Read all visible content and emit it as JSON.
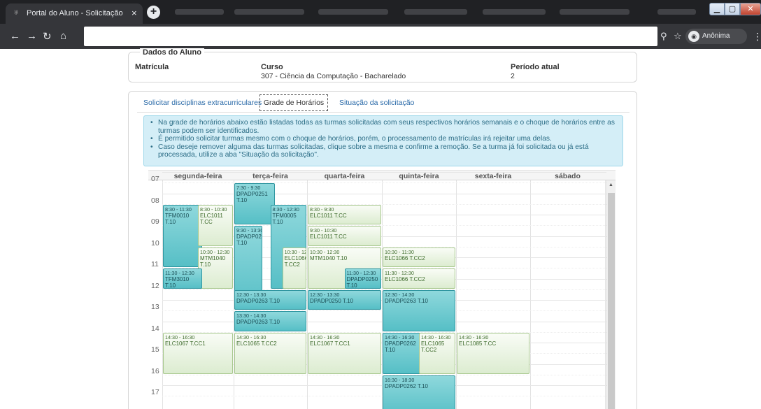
{
  "browser": {
    "tab_title": "Portal do Aluno - Solicitação de",
    "tab_close": "×",
    "new_tab": "+",
    "incognito_label": "Anônima"
  },
  "aluno": {
    "legend": "Dados do Aluno",
    "matricula_label": "Matrícula",
    "curso_label": "Curso",
    "curso_value": "307 - Ciência da Computação - Bacharelado",
    "periodo_label": "Período atual",
    "periodo_value": "2"
  },
  "tabs": [
    {
      "label": "Solicitar disciplinas extracurriculares"
    },
    {
      "label": "Grade de Horários"
    },
    {
      "label": "Situação da solicitação"
    }
  ],
  "alert": [
    "Na grade de horários abaixo estão listadas todas as turmas solicitadas com seus respectivos horários semanais e o choque de horários entre as turmas podem ser identificados.",
    "É permitido solicitar turmas mesmo com o choque de horários, porém, o processamento de matrículas irá rejeitar uma delas.",
    "Caso deseje remover alguma das turmas solicitadas, clique sobre a mesma e confirme a remoção. Se a turma já foi solicitada ou já está processada, utilize a aba \"Situação da solicitação\"."
  ],
  "grid": {
    "days": [
      "segunda-feira",
      "terça-feira",
      "quarta-feira",
      "quinta-feira",
      "sexta-feira",
      "sábado"
    ],
    "hours": [
      "07",
      "08",
      "09",
      "10",
      "11",
      "12",
      "13",
      "14",
      "15",
      "16",
      "17"
    ],
    "events": [
      {
        "day": 1,
        "lane": 0,
        "lanes": 2,
        "start": 7.5,
        "end": 9.5,
        "time": "7:30 - 9:30",
        "name": "DPADP0251 T.10",
        "color": "teal"
      },
      {
        "day": 0,
        "lane": 0,
        "lanes": 2,
        "start": 8.5,
        "end": 11.5,
        "time": "8:30 - 11:30",
        "name": "TFM0010 T.10",
        "color": "teal"
      },
      {
        "day": 0,
        "lane": 1,
        "lanes": 2,
        "start": 8.5,
        "end": 10.5,
        "time": "8:30 - 10:30",
        "name": "ELC1011 T.CC",
        "color": "green"
      },
      {
        "day": 1,
        "lane": 1,
        "lanes": 2,
        "start": 8.5,
        "end": 12.5,
        "time": "8:30 - 12:30",
        "name": "TFM0005 T.10",
        "color": "teal"
      },
      {
        "day": 2,
        "lane": 0,
        "lanes": 1,
        "start": 8.5,
        "end": 9.5,
        "time": "8:30 - 9:30",
        "name": "ELC1011 T.CC",
        "color": "green"
      },
      {
        "day": 1,
        "lane": 0,
        "lanes": 3,
        "start": 9.5,
        "end": 13.5,
        "time": "9:30 - 13:30",
        "name": "DPADP0251 T.10",
        "color": "teal"
      },
      {
        "day": 2,
        "lane": 0,
        "lanes": 1,
        "start": 9.5,
        "end": 10.5,
        "time": "9:30 - 10:30",
        "name": "ELC1011 T.CC",
        "color": "green"
      },
      {
        "day": 0,
        "lane": 1,
        "lanes": 2,
        "start": 10.5,
        "end": 12.5,
        "time": "10:30 - 12:30",
        "name": "MTM1040 T.10",
        "color": "green"
      },
      {
        "day": 1,
        "lane": 2,
        "lanes": 3,
        "start": 10.5,
        "end": 12.5,
        "time": "10:30 - 12:30",
        "name": "ELC1066 T.CC2",
        "color": "green"
      },
      {
        "day": 2,
        "lane": 0,
        "lanes": 1,
        "start": 10.5,
        "end": 12.5,
        "time": "10:30 - 12:30",
        "name": "MTM1040 T.10",
        "color": "green"
      },
      {
        "day": 3,
        "lane": 0,
        "lanes": 1,
        "start": 10.5,
        "end": 11.5,
        "time": "10:30 - 11:30",
        "name": "ELC1066 T.CC2",
        "color": "green"
      },
      {
        "day": 0,
        "lane": 0,
        "lanes": 2,
        "start": 11.5,
        "end": 12.5,
        "time": "11:30 - 12:30",
        "name": "TFM3010 T.10",
        "color": "teal"
      },
      {
        "day": 2,
        "lane": 1,
        "lanes": 2,
        "start": 11.5,
        "end": 12.5,
        "time": "11:30 - 12:30",
        "name": "DPADP0250 T.10",
        "color": "teal"
      },
      {
        "day": 3,
        "lane": 0,
        "lanes": 1,
        "start": 11.5,
        "end": 12.5,
        "time": "11:30 - 12:30",
        "name": "ELC1066 T.CC2",
        "color": "green"
      },
      {
        "day": 1,
        "lane": 0,
        "lanes": 1,
        "start": 12.5,
        "end": 13.5,
        "time": "12:30 - 13:30",
        "name": "DPADP0263 T.10",
        "color": "teal"
      },
      {
        "day": 2,
        "lane": 0,
        "lanes": 1,
        "start": 12.5,
        "end": 13.5,
        "time": "12:30 - 13:30",
        "name": "DPADP0250 T.10",
        "color": "teal"
      },
      {
        "day": 3,
        "lane": 0,
        "lanes": 1,
        "start": 12.5,
        "end": 14.5,
        "time": "12:30 - 14:30",
        "name": "DPADP0263 T.10",
        "color": "teal"
      },
      {
        "day": 1,
        "lane": 0,
        "lanes": 1,
        "start": 13.5,
        "end": 14.5,
        "time": "13:30 - 14:30",
        "name": "DPADP0263 T.10",
        "color": "teal"
      },
      {
        "day": 0,
        "lane": 0,
        "lanes": 1,
        "start": 14.5,
        "end": 16.5,
        "time": "14:30 - 16:30",
        "name": "ELC1067 T.CC1",
        "color": "green"
      },
      {
        "day": 1,
        "lane": 0,
        "lanes": 1,
        "start": 14.5,
        "end": 16.5,
        "time": "14:30 - 16:30",
        "name": "ELC1065 T.CC2",
        "color": "green"
      },
      {
        "day": 2,
        "lane": 0,
        "lanes": 1,
        "start": 14.5,
        "end": 16.5,
        "time": "14:30 - 16:30",
        "name": "ELC1067 T.CC1",
        "color": "green"
      },
      {
        "day": 3,
        "lane": 0,
        "lanes": 2,
        "start": 14.5,
        "end": 16.5,
        "time": "14:30 - 16:30",
        "name": "DPADP0262 T.10",
        "color": "teal"
      },
      {
        "day": 3,
        "lane": 1,
        "lanes": 2,
        "start": 14.5,
        "end": 16.5,
        "time": "14:30 - 16:30",
        "name": "ELC1065 T.CC2",
        "color": "green"
      },
      {
        "day": 4,
        "lane": 0,
        "lanes": 1,
        "start": 14.5,
        "end": 16.5,
        "time": "14:30 - 16:30",
        "name": "ELC1085 T.CC",
        "color": "green"
      },
      {
        "day": 3,
        "lane": 0,
        "lanes": 1,
        "start": 16.5,
        "end": 18.5,
        "time": "16:30 - 18:30",
        "name": "DPADP0262 T.10",
        "color": "teal"
      }
    ]
  }
}
